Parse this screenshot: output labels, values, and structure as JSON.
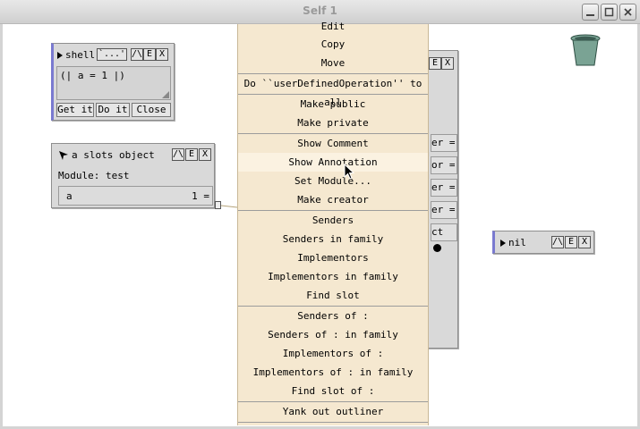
{
  "window": {
    "title": "Self 1"
  },
  "shell": {
    "title": "shell",
    "backtick_btn": "`...'",
    "btn_up": "/\\",
    "btn_e": "E",
    "btn_x": "X",
    "code": "(| a = 1 |)",
    "get_it": "Get it",
    "do_it": "Do it",
    "close": "Close"
  },
  "slots_object": {
    "title": "a slots object",
    "module_label": "Module: test",
    "btn_up": "/\\",
    "btn_e": "E",
    "btn_x": "X",
    "slot_name": "a",
    "slot_value": "1 ="
  },
  "nil_outliner": {
    "title": "nil",
    "btn_up": "/\\",
    "btn_e": "E",
    "btn_x": "X"
  },
  "background_outliner": {
    "btn_e": "E",
    "btn_x": "X",
    "row_fragments": [
      "er =",
      "or =",
      "er =",
      "er =",
      "ct"
    ]
  },
  "menu": {
    "items": [
      "Edit",
      "Copy",
      "Move",
      "Do ``userDefinedOperation'' to all",
      "Make public",
      "Make private",
      "Show Comment",
      "Show Annotation",
      "Set Module...",
      "Make creator",
      "Senders",
      "Senders in family",
      "Implementors",
      "Implementors in family",
      "Find slot",
      "Senders of :",
      "Senders of : in family",
      "Implementors of :",
      "Implementors of : in family",
      "Find slot of :",
      "Yank out outliner"
    ],
    "highlighted": "Show Annotation"
  }
}
